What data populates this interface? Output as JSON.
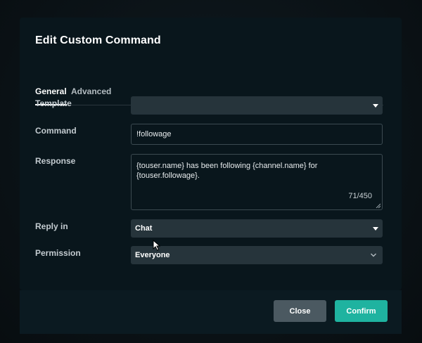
{
  "dialog": {
    "title": "Edit Custom Command"
  },
  "tabs": [
    {
      "label": "General",
      "active": true
    },
    {
      "label": "Advanced",
      "active": false
    }
  ],
  "form": {
    "template": {
      "label": "Template",
      "value": ""
    },
    "command": {
      "label": "Command",
      "value": "!followage"
    },
    "response": {
      "label": "Response",
      "value": "{touser.name} has been following {channel.name} for {touser.followage}.",
      "counter": "71/450"
    },
    "reply_in": {
      "label": "Reply in",
      "value": "Chat"
    },
    "permission": {
      "label": "Permission",
      "value": "Everyone"
    }
  },
  "footer": {
    "close_label": "Close",
    "confirm_label": "Confirm"
  },
  "icons": {
    "dropdown": "caret-down-icon",
    "chevron": "chevron-down-icon",
    "resize": "resize-grip-icon",
    "cursor": "mouse-pointer-icon"
  },
  "colors": {
    "accent": "#1fb3a0",
    "modal_bg": "#09161c",
    "select_bg": "#26343b",
    "close_button": "#4b5961"
  }
}
